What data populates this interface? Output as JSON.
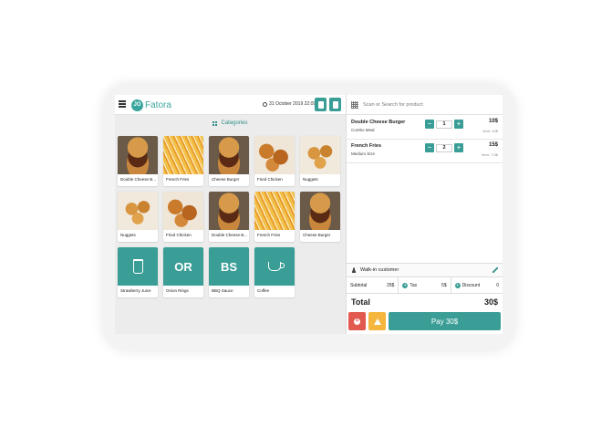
{
  "app": {
    "logo_mark": "JO",
    "name": "Fatora"
  },
  "header": {
    "date": "31 October 2019 22:09"
  },
  "categories_label": "Categories",
  "products": [
    {
      "name": "Double Cheese B...",
      "image": "burger"
    },
    {
      "name": "French Fries",
      "image": "fries"
    },
    {
      "name": "Cheese Burger",
      "image": "burger"
    },
    {
      "name": "Fried Chicken",
      "image": "chicken"
    },
    {
      "name": "Nuggets",
      "image": "nuggets"
    },
    {
      "name": "Nuggets",
      "image": "nuggets"
    },
    {
      "name": "Fried Chicken",
      "image": "chicken"
    },
    {
      "name": "Double Cheese B...",
      "image": "burger"
    },
    {
      "name": "French Fries",
      "image": "fries"
    },
    {
      "name": "Cheese Burger",
      "image": "burger"
    },
    {
      "name": "Strawberry Juice",
      "image": "cup-icon"
    },
    {
      "name": "Onion Rings",
      "image": "text",
      "text": "OR"
    },
    {
      "name": "BBQ Sauce",
      "image": "text",
      "text": "BS"
    },
    {
      "name": "Coffee",
      "image": "coffee-icon"
    }
  ],
  "search": {
    "placeholder": "Scan or Search for product"
  },
  "cart": [
    {
      "name": "Double Cheese Burger",
      "sub": "Combo Meal",
      "qty": "1",
      "price": "10$",
      "unit": "Item: 10$"
    },
    {
      "name": "French Fries",
      "sub": "Medium Size",
      "qty": "2",
      "price": "15$",
      "unit": "Item: 7.5$"
    }
  ],
  "customer": "Walk-in customer",
  "totals": {
    "subtotal_label": "Subtotal",
    "subtotal": "25$",
    "tax_label": "Tax",
    "tax": "5$",
    "discount_label": "Discount",
    "discount": "0",
    "total_label": "Total",
    "total": "30$"
  },
  "pay_label": "Pay 30$",
  "colors": {
    "accent": "#3a9e96",
    "cancel": "#e25a4f",
    "warning": "#f4b63c"
  }
}
